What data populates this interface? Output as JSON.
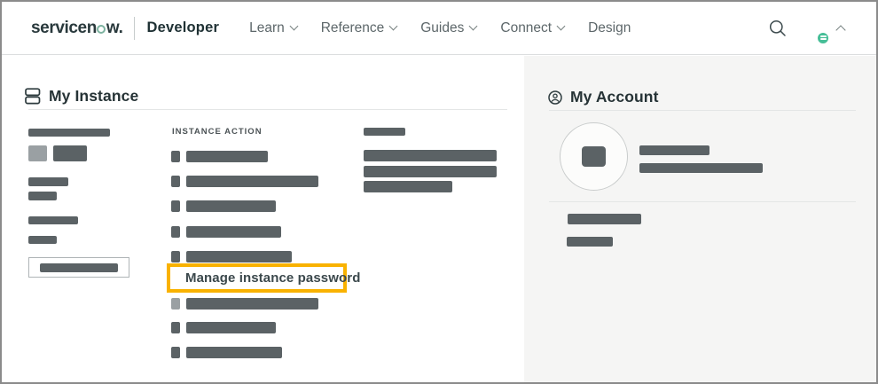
{
  "header": {
    "brand": {
      "wordmark_prefix": "servicen",
      "wordmark_suffix": "w.",
      "product": "Developer"
    },
    "nav_items": [
      {
        "label": "Learn",
        "dropdown": true
      },
      {
        "label": "Reference",
        "dropdown": true
      },
      {
        "label": "Guides",
        "dropdown": true
      },
      {
        "label": "Connect",
        "dropdown": true
      },
      {
        "label": "Design",
        "dropdown": false
      }
    ]
  },
  "my_instance": {
    "title": "My Instance",
    "action_section_label": "INSTANCE ACTION",
    "highlighted_action": {
      "label": "Manage instance password"
    }
  },
  "my_account": {
    "title": "My Account"
  },
  "icons": {
    "logo_o_ring": "green ring replacing o in servicenow wordmark",
    "search": "search-icon (magnifier)",
    "avatar_badge": "green instance status badge on avatar",
    "my_instance": "server-stack-icon",
    "my_account": "person-in-circle-icon",
    "highlighted_action": "lock-icon",
    "nav_dropdown": "chevron-down-icon",
    "avatar_caret": "chevron-up-icon"
  },
  "colors": {
    "highlight_border": "#F9B200",
    "bar_dark": "#5B6265",
    "bar_light": "#929899",
    "right_panel_bg": "#F5F5F4",
    "brand_green": "#7DB3A0",
    "badge_green": "#46BE97",
    "text_dark": "#29393C",
    "nav_gray": "#5D676A"
  }
}
